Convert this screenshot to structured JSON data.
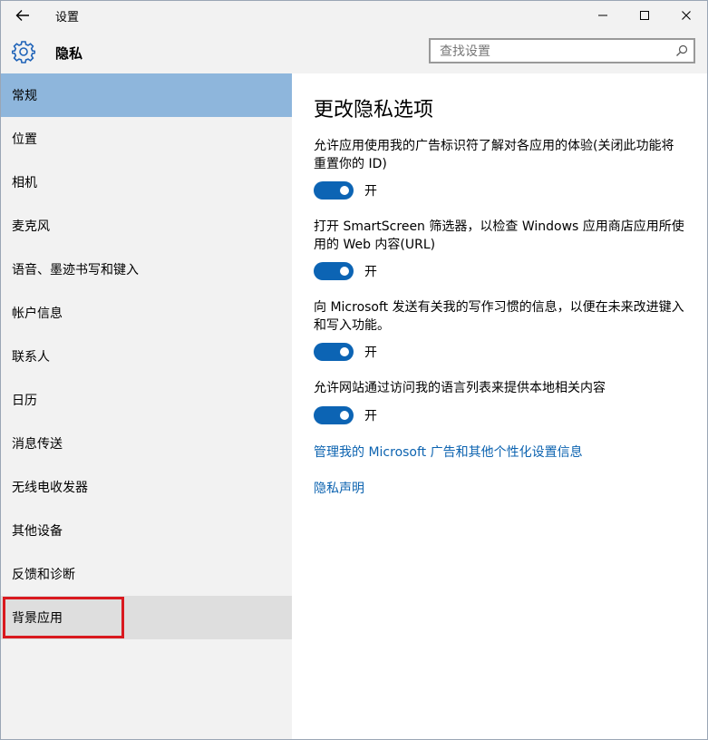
{
  "window": {
    "title": "设置"
  },
  "header": {
    "title": "隐私",
    "search_placeholder": "查找设置"
  },
  "sidebar": {
    "items": [
      {
        "label": "常规",
        "state": "active"
      },
      {
        "label": "位置"
      },
      {
        "label": "相机"
      },
      {
        "label": "麦克风"
      },
      {
        "label": "语音、墨迹书写和键入"
      },
      {
        "label": "帐户信息"
      },
      {
        "label": "联系人"
      },
      {
        "label": "日历"
      },
      {
        "label": "消息传送"
      },
      {
        "label": "无线电收发器"
      },
      {
        "label": "其他设备"
      },
      {
        "label": "反馈和诊断"
      },
      {
        "label": "背景应用",
        "state": "hover",
        "highlighted": true
      }
    ]
  },
  "main": {
    "title": "更改隐私选项",
    "settings": [
      {
        "description": "允许应用使用我的广告标识符了解对各应用的体验(关闭此功能将重置你的 ID)",
        "toggle_label": "开",
        "on": true
      },
      {
        "description": "打开 SmartScreen 筛选器，以检查 Windows 应用商店应用所使用的 Web 内容(URL)",
        "toggle_label": "开",
        "on": true
      },
      {
        "description": "向 Microsoft 发送有关我的写作习惯的信息，以便在未来改进键入和写入功能。",
        "toggle_label": "开",
        "on": true
      },
      {
        "description": "允许网站通过访问我的语言列表来提供本地相关内容",
        "toggle_label": "开",
        "on": true
      }
    ],
    "links": [
      {
        "label": "管理我的 Microsoft 广告和其他个性化设置信息"
      },
      {
        "label": "隐私声明"
      }
    ]
  },
  "colors": {
    "accent": "#0c64b4",
    "active_nav": "#8eb6dc",
    "link": "#0c63b0",
    "highlight_border": "#d9191f"
  },
  "icons": {
    "back": "back-arrow-icon",
    "header": "gear-icon",
    "search": "search-icon"
  }
}
